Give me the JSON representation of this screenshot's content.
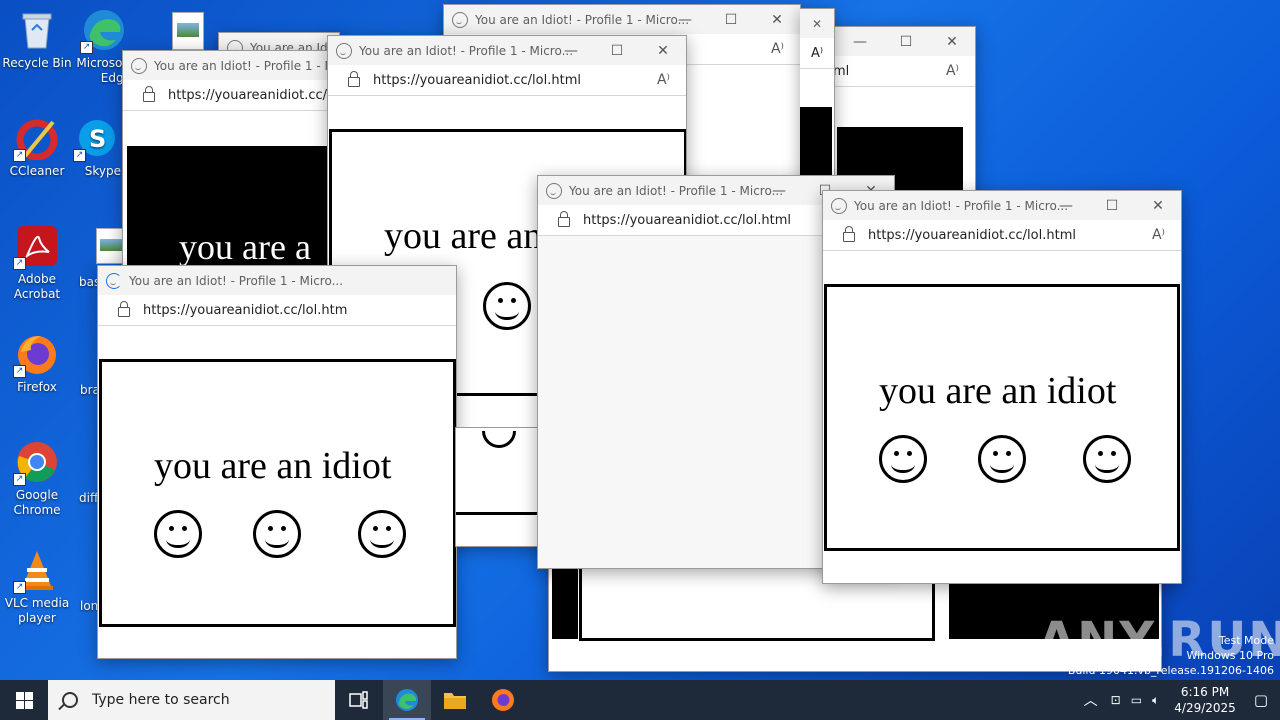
{
  "desktop_icons": [
    {
      "id": "recycle",
      "label": "Recycle Bin"
    },
    {
      "id": "edge",
      "label": "Microsoft Edge"
    },
    {
      "id": "ccleaner",
      "label": "CCleaner"
    },
    {
      "id": "skype",
      "label": "Skype"
    },
    {
      "id": "acrobat",
      "label": "Adobe Acrobat"
    },
    {
      "id": "firefox",
      "label": "Firefox"
    },
    {
      "id": "chrome",
      "label": "Google Chrome"
    },
    {
      "id": "vlc",
      "label": "VLC media player"
    }
  ],
  "partial_icons": [
    "bas",
    "bra",
    "diff",
    "lon"
  ],
  "window": {
    "title": "You are an Idiot! - Profile 1 - Micro...",
    "url": "https://youareanidiot.cc/lol.html",
    "url_cut1": "https://youareanidiot.cc/lol.htm",
    "url_cut2": "https://youareanidiot.cc/lo",
    "url_cut3": "ml",
    "title_cut": "You are an Idiot",
    "message": "you are an idiot",
    "message_cut": "you are an",
    "message_cut2": "you are a"
  },
  "taskbar": {
    "search_placeholder": "Type here to search",
    "time": "6:16 PM",
    "date": "4/29/2025"
  },
  "watermark": {
    "line1": "Test Mode",
    "line2": "Windows 10 Pro",
    "line3": "Build 19041.vb_release.191206-1406",
    "brand": "ANY.RUN"
  },
  "colors": {
    "desktop": "#0b5bd8",
    "taskbar": "#1e2a3a"
  }
}
